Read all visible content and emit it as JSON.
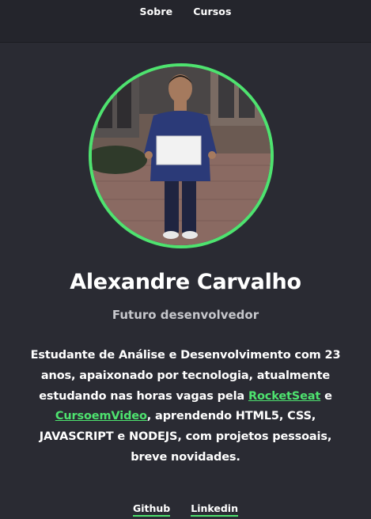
{
  "nav": {
    "items": [
      {
        "label": "Sobre"
      },
      {
        "label": "Cursos"
      }
    ]
  },
  "profile": {
    "name": "Alexandre Carvalho",
    "subtitle": "Futuro desenvolvedor"
  },
  "bio": {
    "line1": "Estudante de Análise e Desenvolvimento com 23 anos, apaixonado por tecnologia, atualmente estudando nas horas vagas pela ",
    "link1": "RocketSeat",
    "connector": " e ",
    "link2": "CursoemVideo",
    "line2": ", aprendendo HTML5, CSS, JAVASCRIPT e NODEJS, com projetos pessoais, breve novidades."
  },
  "footer": {
    "links": [
      {
        "label": "Github"
      },
      {
        "label": "Linkedin"
      }
    ]
  },
  "colors": {
    "accent": "#4ee36f",
    "background": "#2a2b33",
    "nav_background": "#24252c",
    "subtitle": "#c6c7cc"
  }
}
